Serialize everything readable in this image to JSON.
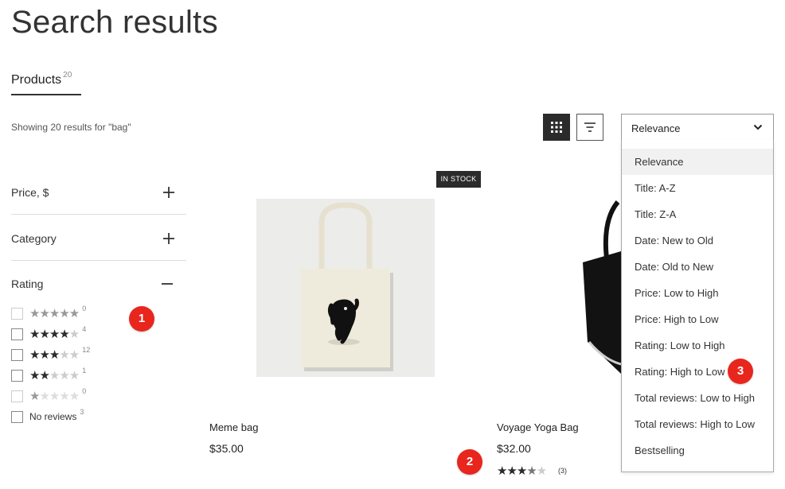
{
  "page": {
    "title": "Search results"
  },
  "tab": {
    "label": "Products",
    "count": "20"
  },
  "summary": "Showing 20 results for \"bag\"",
  "sort": {
    "selected": "Relevance",
    "options": [
      "Relevance",
      "Title: A-Z",
      "Title: Z-A",
      "Date: New to Old",
      "Date: Old to New",
      "Price: Low to High",
      "Price: High to Low",
      "Rating: Low to High",
      "Rating: High to Low",
      "Total reviews: Low to High",
      "Total reviews: High to Low",
      "Bestselling"
    ]
  },
  "filters": {
    "price": "Price, $",
    "category": "Category",
    "rating": "Rating",
    "rating_rows": [
      {
        "stars": 5,
        "count": "0",
        "enabled": false
      },
      {
        "stars": 4,
        "count": "4",
        "enabled": true
      },
      {
        "stars": 3,
        "count": "12",
        "enabled": true
      },
      {
        "stars": 2,
        "count": "1",
        "enabled": true
      },
      {
        "stars": 1,
        "count": "0",
        "enabled": false
      }
    ],
    "no_reviews": {
      "label": "No reviews",
      "count": "3"
    }
  },
  "products": [
    {
      "badge": "IN STOCK",
      "name": "Meme bag",
      "price": "$35.00"
    },
    {
      "name": "Voyage Yoga Bag",
      "price": "$32.00",
      "rating": 3.5,
      "reviews": "(3)"
    }
  ],
  "annotations": [
    "1",
    "2",
    "3"
  ],
  "icons": {
    "grid_view": "grid-icon",
    "list_view": "filter-lines-icon",
    "sort_chevron": "chevron-down-icon",
    "expand": "plus-icon",
    "collapse": "minus-icon"
  },
  "colors": {
    "annotation": "#e8261d",
    "dark": "#2b2b2b"
  }
}
